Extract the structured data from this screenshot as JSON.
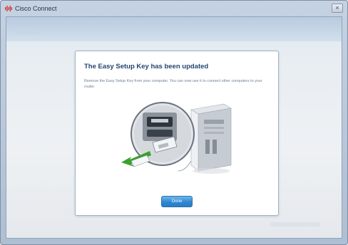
{
  "window": {
    "title": "Cisco Connect",
    "close_glyph": "×"
  },
  "dialog": {
    "title": "The Easy Setup Key has been updated",
    "body": "Remove the Easy Setup Key from your computer. You can now use it to connect other computers to your router.",
    "done_label": "Done"
  },
  "icons": {
    "app": "cisco-logo-icon",
    "arrow": "green-arrow-icon"
  },
  "colors": {
    "title_text": "#23466e",
    "button": "#2f86d0",
    "arrow": "#3aa12d"
  }
}
